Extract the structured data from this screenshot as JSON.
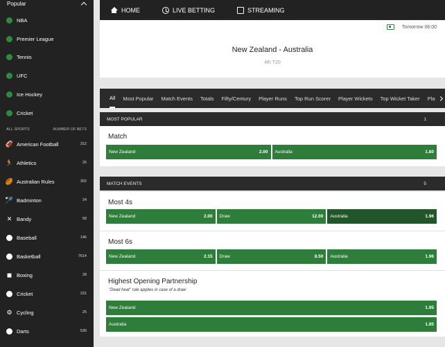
{
  "sidebar": {
    "header": "Popular",
    "popular": [
      "NBA",
      "Premier League",
      "Tennis",
      "UFC",
      "Ice Hockey",
      "Cricket"
    ],
    "all_sports_label": "ALL SPORTS",
    "num_bets_label": "NUMBER OF BETS",
    "sports": [
      {
        "label": "American Football",
        "count": "312"
      },
      {
        "label": "Athletics",
        "count": "25"
      },
      {
        "label": "Australian Rules",
        "count": "302"
      },
      {
        "label": "Badminton",
        "count": "24"
      },
      {
        "label": "Bandy",
        "count": "58"
      },
      {
        "label": "Baseball",
        "count": "146"
      },
      {
        "label": "Basketball",
        "count": "7614"
      },
      {
        "label": "Boxing",
        "count": "28"
      },
      {
        "label": "Cricket",
        "count": "231"
      },
      {
        "label": "Cycling",
        "count": "25"
      },
      {
        "label": "Darts",
        "count": "530"
      }
    ]
  },
  "topnav": {
    "home": "HOME",
    "live": "LIVE BETTING",
    "streaming": "STREAMING"
  },
  "event": {
    "time": "Tomorrow 06:00",
    "title": "New Zealand - Australia",
    "subtitle": "4th T20"
  },
  "tabs": [
    "All",
    "Most Popular",
    "Match Events",
    "Totals",
    "Fifty/Century",
    "Player Runs",
    "Top Run Scorer",
    "Player Wickets",
    "Top Wicket Taker",
    "Play"
  ],
  "most_popular": {
    "label": "MOST POPULAR",
    "count": "1",
    "match": {
      "title": "Match",
      "home": "New Zealand",
      "home_price": "2.00",
      "away": "Australia",
      "away_price": "1.80"
    }
  },
  "match_events": {
    "label": "MATCH EVENTS",
    "count": "5",
    "most4s": {
      "title": "Most 4s",
      "home": "New Zealand",
      "home_price": "2.00",
      "draw": "Draw",
      "draw_price": "12.00",
      "away": "Australia",
      "away_price": "1.96"
    },
    "most6s": {
      "title": "Most 6s",
      "home": "New Zealand",
      "home_price": "2.15",
      "draw": "Draw",
      "draw_price": "8.50",
      "away": "Australia",
      "away_price": "1.96"
    },
    "opening": {
      "title": "Highest Opening Partnership",
      "note": "\"Dead heat\" rule applies in case of a draw",
      "home": "New Zealand",
      "home_price": "1.95",
      "away": "Australia",
      "away_price": "1.85"
    }
  },
  "colors": {
    "accent": "#2f7d3a",
    "accent_dark": "#22552a",
    "dark": "#222222"
  }
}
